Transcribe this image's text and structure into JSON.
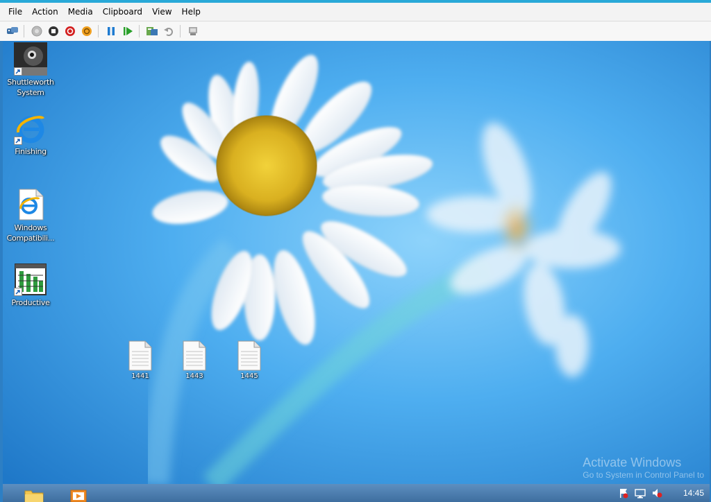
{
  "menubar": {
    "items": [
      "File",
      "Action",
      "Media",
      "Clipboard",
      "View",
      "Help"
    ]
  },
  "toolbar": {
    "buttons": [
      "ctrl-alt-del-icon",
      "start-icon",
      "turn-off-icon",
      "shut-down-icon",
      "save-icon",
      "pause-icon",
      "reset-icon",
      "checkpoint-icon",
      "revert-icon",
      "enhanced-session-icon"
    ]
  },
  "desktop": {
    "icons": [
      {
        "label_line1": "Shuttleworth",
        "label_line2": "System"
      },
      {
        "label_line1": "Finishing",
        "label_line2": ""
      },
      {
        "label_line1": "Windows",
        "label_line2": "Compatibili..."
      },
      {
        "label_line1": "Productive",
        "label_line2": ""
      }
    ],
    "files": [
      "1441",
      "1443",
      "1445"
    ]
  },
  "watermark": {
    "line1": "Activate Windows",
    "line2": "Go to System in Control Panel to"
  },
  "taskbar": {
    "clock": "14:45"
  },
  "colors": {
    "accent": "#29a9d8",
    "taskbar": "#4a7cb0",
    "desktop": "#4aa4e8"
  }
}
